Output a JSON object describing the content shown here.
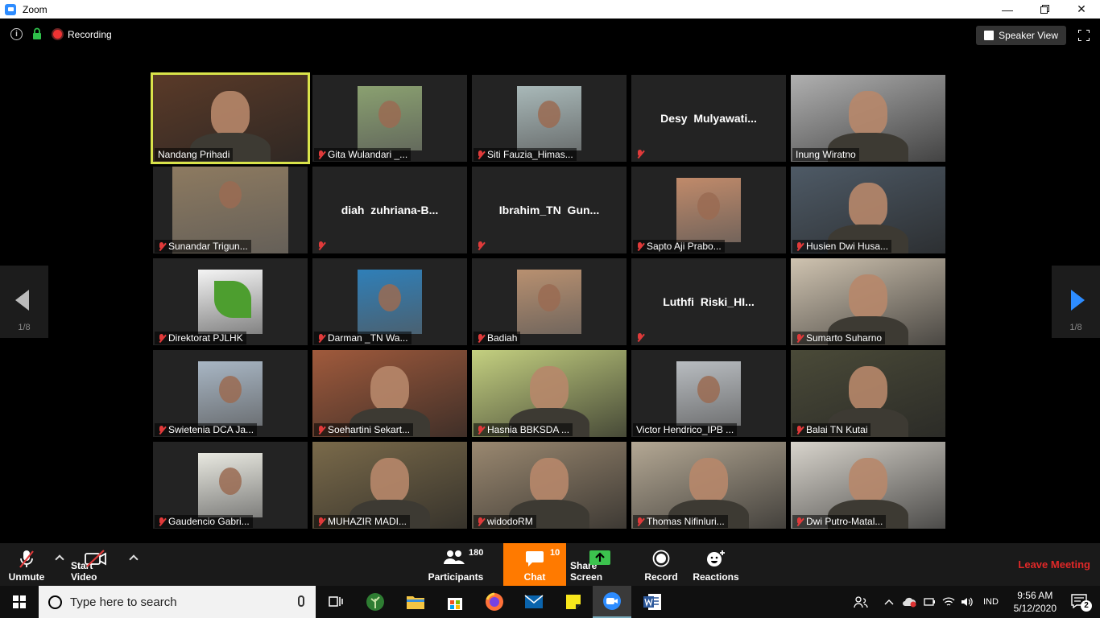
{
  "window": {
    "title": "Zoom"
  },
  "topbar": {
    "recording_label": "Recording",
    "view_label": "Speaker View"
  },
  "pager": {
    "left_page": "1/8",
    "right_page": "1/8"
  },
  "participants": [
    {
      "name": "Nandang Prihadi",
      "muted": false,
      "mode": "video",
      "active": true,
      "bg": "#5a3a28"
    },
    {
      "name": "Gita Wulandari _...",
      "muted": true,
      "mode": "photo",
      "bg": "#8aa070"
    },
    {
      "name": "Siti Fauzia_Himas...",
      "muted": true,
      "mode": "photo",
      "bg": "#a8b8b8"
    },
    {
      "name": "Desy  Mulyawati...",
      "muted": true,
      "mode": "text"
    },
    {
      "name": "Inung Wiratno",
      "muted": false,
      "mode": "video",
      "bg": "#b0b0b0"
    },
    {
      "name": "Sunandar Trigun...",
      "muted": true,
      "mode": "photo-wide",
      "bg": "#8d7a60"
    },
    {
      "name": "diah  zuhriana-B...",
      "muted": true,
      "mode": "text",
      "hide_label": true
    },
    {
      "name": "Ibrahim_TN  Gun...",
      "muted": true,
      "mode": "text"
    },
    {
      "name": "Sapto Aji Prabo...",
      "muted": true,
      "mode": "photo",
      "bg": "#c08a6a"
    },
    {
      "name": "Husien Dwi Husa...",
      "muted": true,
      "mode": "video",
      "bg": "#4e5a66"
    },
    {
      "name": "Direktorat PJLHK",
      "muted": true,
      "mode": "photo",
      "bg": "#f4f4f4",
      "accent": "#4d9e2f"
    },
    {
      "name": "Darman _TN Wa...",
      "muted": true,
      "mode": "photo",
      "bg": "#2f7fb8"
    },
    {
      "name": "Badiah",
      "muted": true,
      "mode": "photo",
      "bg": "#b89070"
    },
    {
      "name": "Luthfi  Riski_HI...",
      "muted": true,
      "mode": "text"
    },
    {
      "name": "Sumarto Suharno",
      "muted": true,
      "mode": "video",
      "bg": "#cfc3b0"
    },
    {
      "name": "Swietenia DCA Ja...",
      "muted": true,
      "mode": "photo",
      "bg": "#a8b6c4"
    },
    {
      "name": "Soehartini Sekart...",
      "muted": true,
      "mode": "video",
      "bg": "#a05a3c"
    },
    {
      "name": "Hasnia BBKSDA ...",
      "muted": true,
      "mode": "video",
      "bg": "#c4d080"
    },
    {
      "name": "Victor Hendrico_IPB ...",
      "muted": false,
      "mode": "photo",
      "bg": "#b8bcc0"
    },
    {
      "name": "Balai TN Kutai",
      "muted": true,
      "mode": "video",
      "bg": "#4a4a38"
    },
    {
      "name": "Gaudencio Gabri...",
      "muted": true,
      "mode": "photo",
      "bg": "#e8e8e0"
    },
    {
      "name": "MUHAZIR MADI...",
      "muted": true,
      "mode": "video",
      "bg": "#7a6a4a"
    },
    {
      "name": "widodoRM",
      "muted": true,
      "mode": "video",
      "bg": "#9a8870"
    },
    {
      "name": "Thomas Nifinluri...",
      "muted": true,
      "mode": "video",
      "bg": "#b4a894"
    },
    {
      "name": "Dwi Putro-Matal...",
      "muted": true,
      "mode": "video",
      "bg": "#d8d4cc"
    }
  ],
  "controls": {
    "unmute": "Unmute",
    "start_video": "Start Video",
    "participants": "Participants",
    "participants_count": "180",
    "chat": "Chat",
    "chat_count": "10",
    "share_screen": "Share Screen",
    "record": "Record",
    "reactions": "Reactions",
    "leave": "Leave Meeting"
  },
  "taskbar": {
    "search_placeholder": "Type here to search",
    "lang": "IND",
    "time": "9:56 AM",
    "date": "5/12/2020",
    "notifications": "2"
  }
}
